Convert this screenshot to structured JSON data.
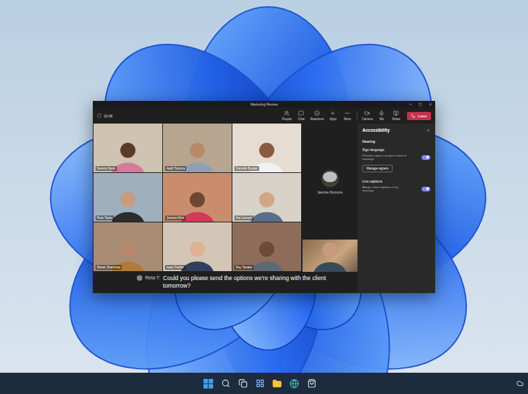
{
  "window": {
    "title": "Marketing Review"
  },
  "meeting": {
    "time": "22:06"
  },
  "toolbar": [
    {
      "label": "People"
    },
    {
      "label": "Chat"
    },
    {
      "label": "Reactions"
    },
    {
      "label": "Apps"
    },
    {
      "label": "More"
    },
    {
      "label": "Camera"
    },
    {
      "label": "Mic"
    },
    {
      "label": "Share"
    }
  ],
  "leave_button": {
    "label": "Leave"
  },
  "tiles": [
    {
      "name": "Serena Davis"
    },
    {
      "name": "Aadil Tokuma"
    },
    {
      "name": "Danielle Booker"
    },
    {
      "name": "Reta Taylor"
    },
    {
      "name": "Jessica Kline"
    },
    {
      "name": "Kat Larsson"
    },
    {
      "name": "Babak Shammas"
    },
    {
      "name": "Isaac Fielder"
    },
    {
      "name": "Ray Tanaka"
    }
  ],
  "spotlight": {
    "name": "Jasmine Simmons"
  },
  "accessibility": {
    "title": "Accessibility",
    "section": "Hearing",
    "settings": [
      {
        "label": "Sign language",
        "description": "Prioritize signers on your screen in meetings",
        "on": true,
        "button": "Manage signers"
      },
      {
        "label": "Live captions",
        "description": "Always show captions in my meetings",
        "on": true,
        "button": ""
      }
    ]
  },
  "caption": {
    "speaker": "Reta T:",
    "text": "Could you please send the options we're sharing with the client tomorrow?"
  }
}
